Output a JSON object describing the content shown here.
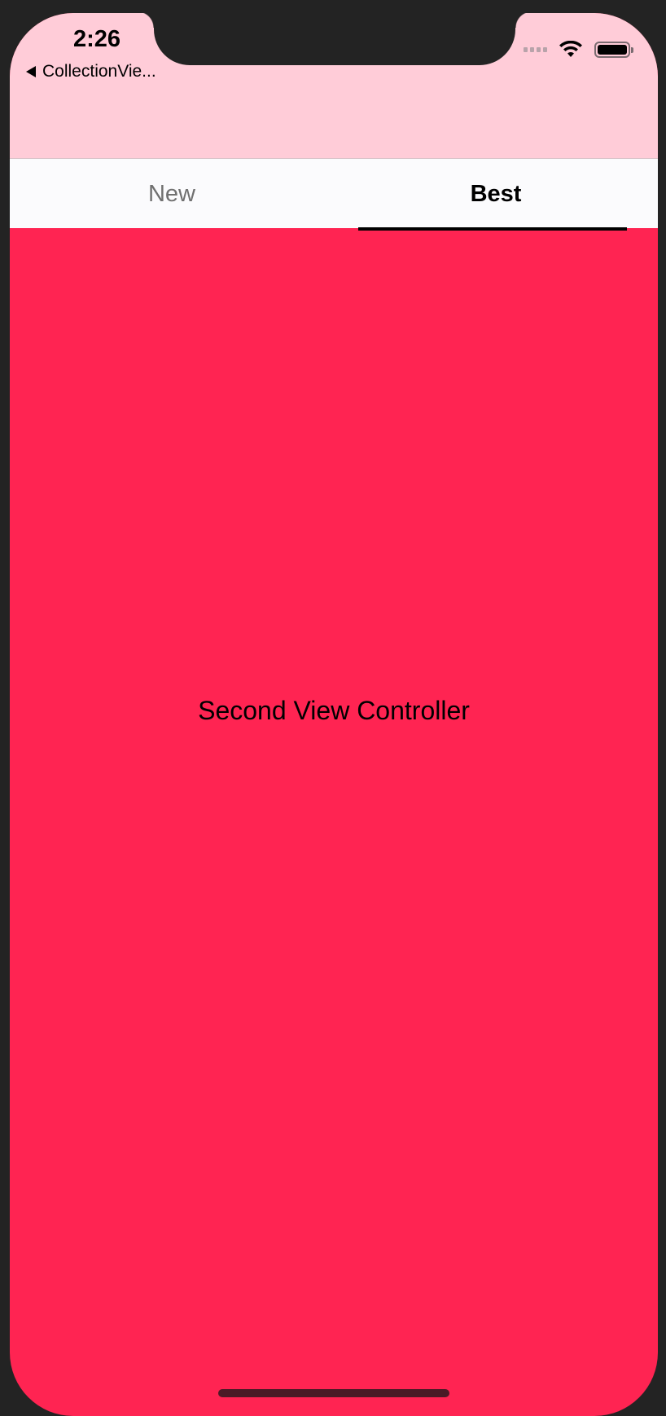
{
  "status_bar": {
    "time": "2:26",
    "signal_icon": "cellular-signal-icon",
    "wifi_icon": "wifi-icon",
    "battery_icon": "battery-icon"
  },
  "nav": {
    "back_label": "CollectionVie..."
  },
  "tabs": [
    {
      "label": "New",
      "selected": false
    },
    {
      "label": "Best",
      "selected": true
    }
  ],
  "content": {
    "label": "Second View Controller"
  },
  "colors": {
    "header": "#ffccd8",
    "content_background": "#ff2452",
    "tab_bar": "#fbfbfd"
  }
}
